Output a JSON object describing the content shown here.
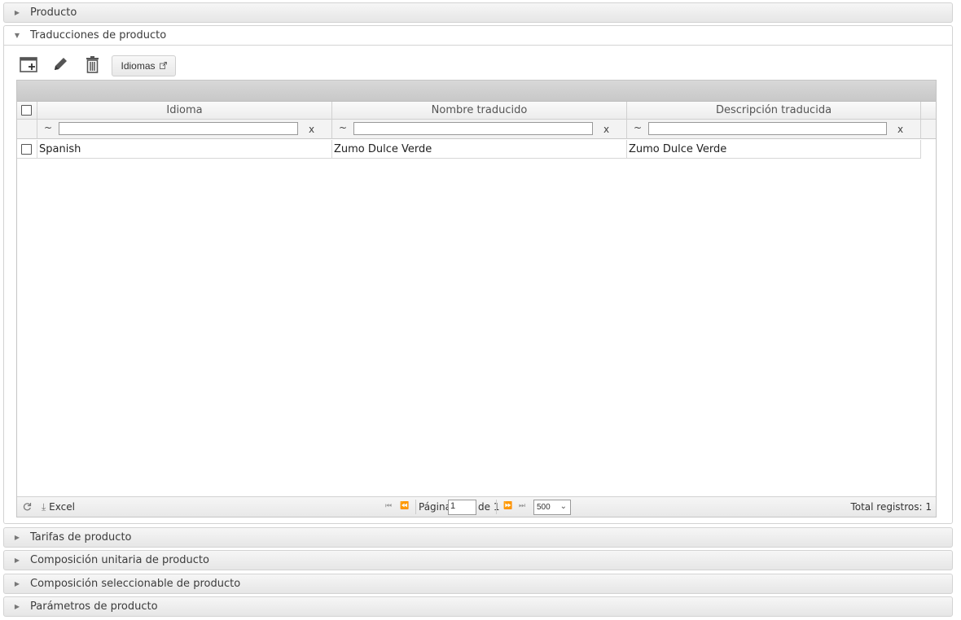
{
  "sections": [
    {
      "label": "Producto",
      "state": "collapsed"
    },
    {
      "label": "Traducciones de producto",
      "state": "expanded"
    },
    {
      "label": "Tarifas de producto",
      "state": "collapsed"
    },
    {
      "label": "Composición unitaria de producto",
      "state": "collapsed"
    },
    {
      "label": "Composición seleccionable de producto",
      "state": "collapsed"
    },
    {
      "label": "Parámetros de producto",
      "state": "collapsed"
    }
  ],
  "toolbar": {
    "icons": [
      "add-window-icon",
      "pencil-icon",
      "trash-icon"
    ],
    "idiomas_label": "Idiomas",
    "idiomas_icon": "external-link-icon"
  },
  "grid": {
    "columns": [
      "Idioma",
      "Nombre traducido",
      "Descripción traducida"
    ],
    "filter": {
      "tilde": "~",
      "clear": "x"
    },
    "rows": [
      {
        "idioma": "Spanish",
        "nombre": "Zumo Dulce Verde",
        "descripcion": "Zumo Dulce Verde"
      }
    ]
  },
  "pager": {
    "refresh_icon": "refresh-icon",
    "excel_label": "Excel",
    "page_label": "Página",
    "page_value": "1",
    "of_label": "de 1",
    "page_size": "500",
    "total_label": "Total registros: 1"
  },
  "colors": {
    "header_bg": "#e6e6e6",
    "border": "#d3d3d3",
    "caption_bg": "#cccccc"
  }
}
